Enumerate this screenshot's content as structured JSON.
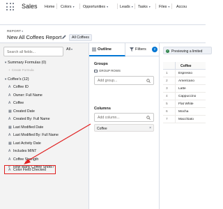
{
  "app": {
    "name": "Sales"
  },
  "nav": {
    "items": [
      {
        "label": "Home",
        "has_menu": false
      },
      {
        "label": "Colors",
        "has_menu": true
      },
      {
        "label": "Opportunities",
        "has_menu": true
      },
      {
        "label": "Leads",
        "has_menu": true
      },
      {
        "label": "Tasks",
        "has_menu": true
      },
      {
        "label": "Files",
        "has_menu": true
      },
      {
        "label": "Accou",
        "has_menu": false
      }
    ],
    "menu_glyph": "▾"
  },
  "report": {
    "type_label": "REPORT",
    "type_glyph": "▾",
    "title": "New All Coffees Report",
    "badge": "All Coffees"
  },
  "fields_panel": {
    "search_placeholder": "Search all fields...",
    "filter_label": "All",
    "filter_glyph": "▾",
    "groups": [
      {
        "label": "Summary Formulas (0)",
        "expanded": true
      },
      {
        "label": "Coffee's (12)",
        "expanded": true
      }
    ],
    "create_formula": "Create Formula",
    "fields": [
      {
        "type_glyph": "A",
        "label": "Coffee ID"
      },
      {
        "type_glyph": "A",
        "label": "Owner: Full Name"
      },
      {
        "type_glyph": "A",
        "label": "Coffee"
      },
      {
        "type_glyph": "▦",
        "label": "Created Date"
      },
      {
        "type_glyph": "A",
        "label": "Created By: Full Name"
      },
      {
        "type_glyph": "▦",
        "label": "Last Modified Date"
      },
      {
        "type_glyph": "A",
        "label": "Last Modified By: Full Name"
      },
      {
        "type_glyph": "▦",
        "label": "Last Activity Date"
      },
      {
        "type_glyph": "A",
        "label": "Includes MINT"
      },
      {
        "type_glyph": "A",
        "label": "Coffee Strength"
      },
      {
        "type_glyph": "#",
        "label": "How Many Coffee Shots?"
      },
      {
        "type_glyph": "A",
        "label": "Color Field Checked"
      }
    ],
    "highlighted_field_index": 11
  },
  "outline_panel": {
    "tabs": [
      {
        "label": "Outline",
        "active": true
      },
      {
        "label": "Filters",
        "active": false,
        "count": "2"
      }
    ],
    "groups_title": "Groups",
    "group_rows_label": "GROUP ROWS",
    "add_group_placeholder": "Add group...",
    "columns_title": "Columns",
    "add_column_placeholder": "Add column...",
    "columns": [
      {
        "label": "Coffee"
      }
    ]
  },
  "preview": {
    "status": "Previewing a limited",
    "column_header": "Coffee",
    "rows": [
      {
        "num": "1",
        "value": "Espresso"
      },
      {
        "num": "2",
        "value": "Americano"
      },
      {
        "num": "3",
        "value": "Latte"
      },
      {
        "num": "4",
        "value": "Cappuccino"
      },
      {
        "num": "5",
        "value": "Flat White"
      },
      {
        "num": "6",
        "value": "Mocha"
      },
      {
        "num": "7",
        "value": "Macchiato"
      }
    ]
  },
  "colors": {
    "accent_blue": "#0176d3",
    "highlight_red": "#e02020",
    "preview_green": "#2e844a"
  }
}
